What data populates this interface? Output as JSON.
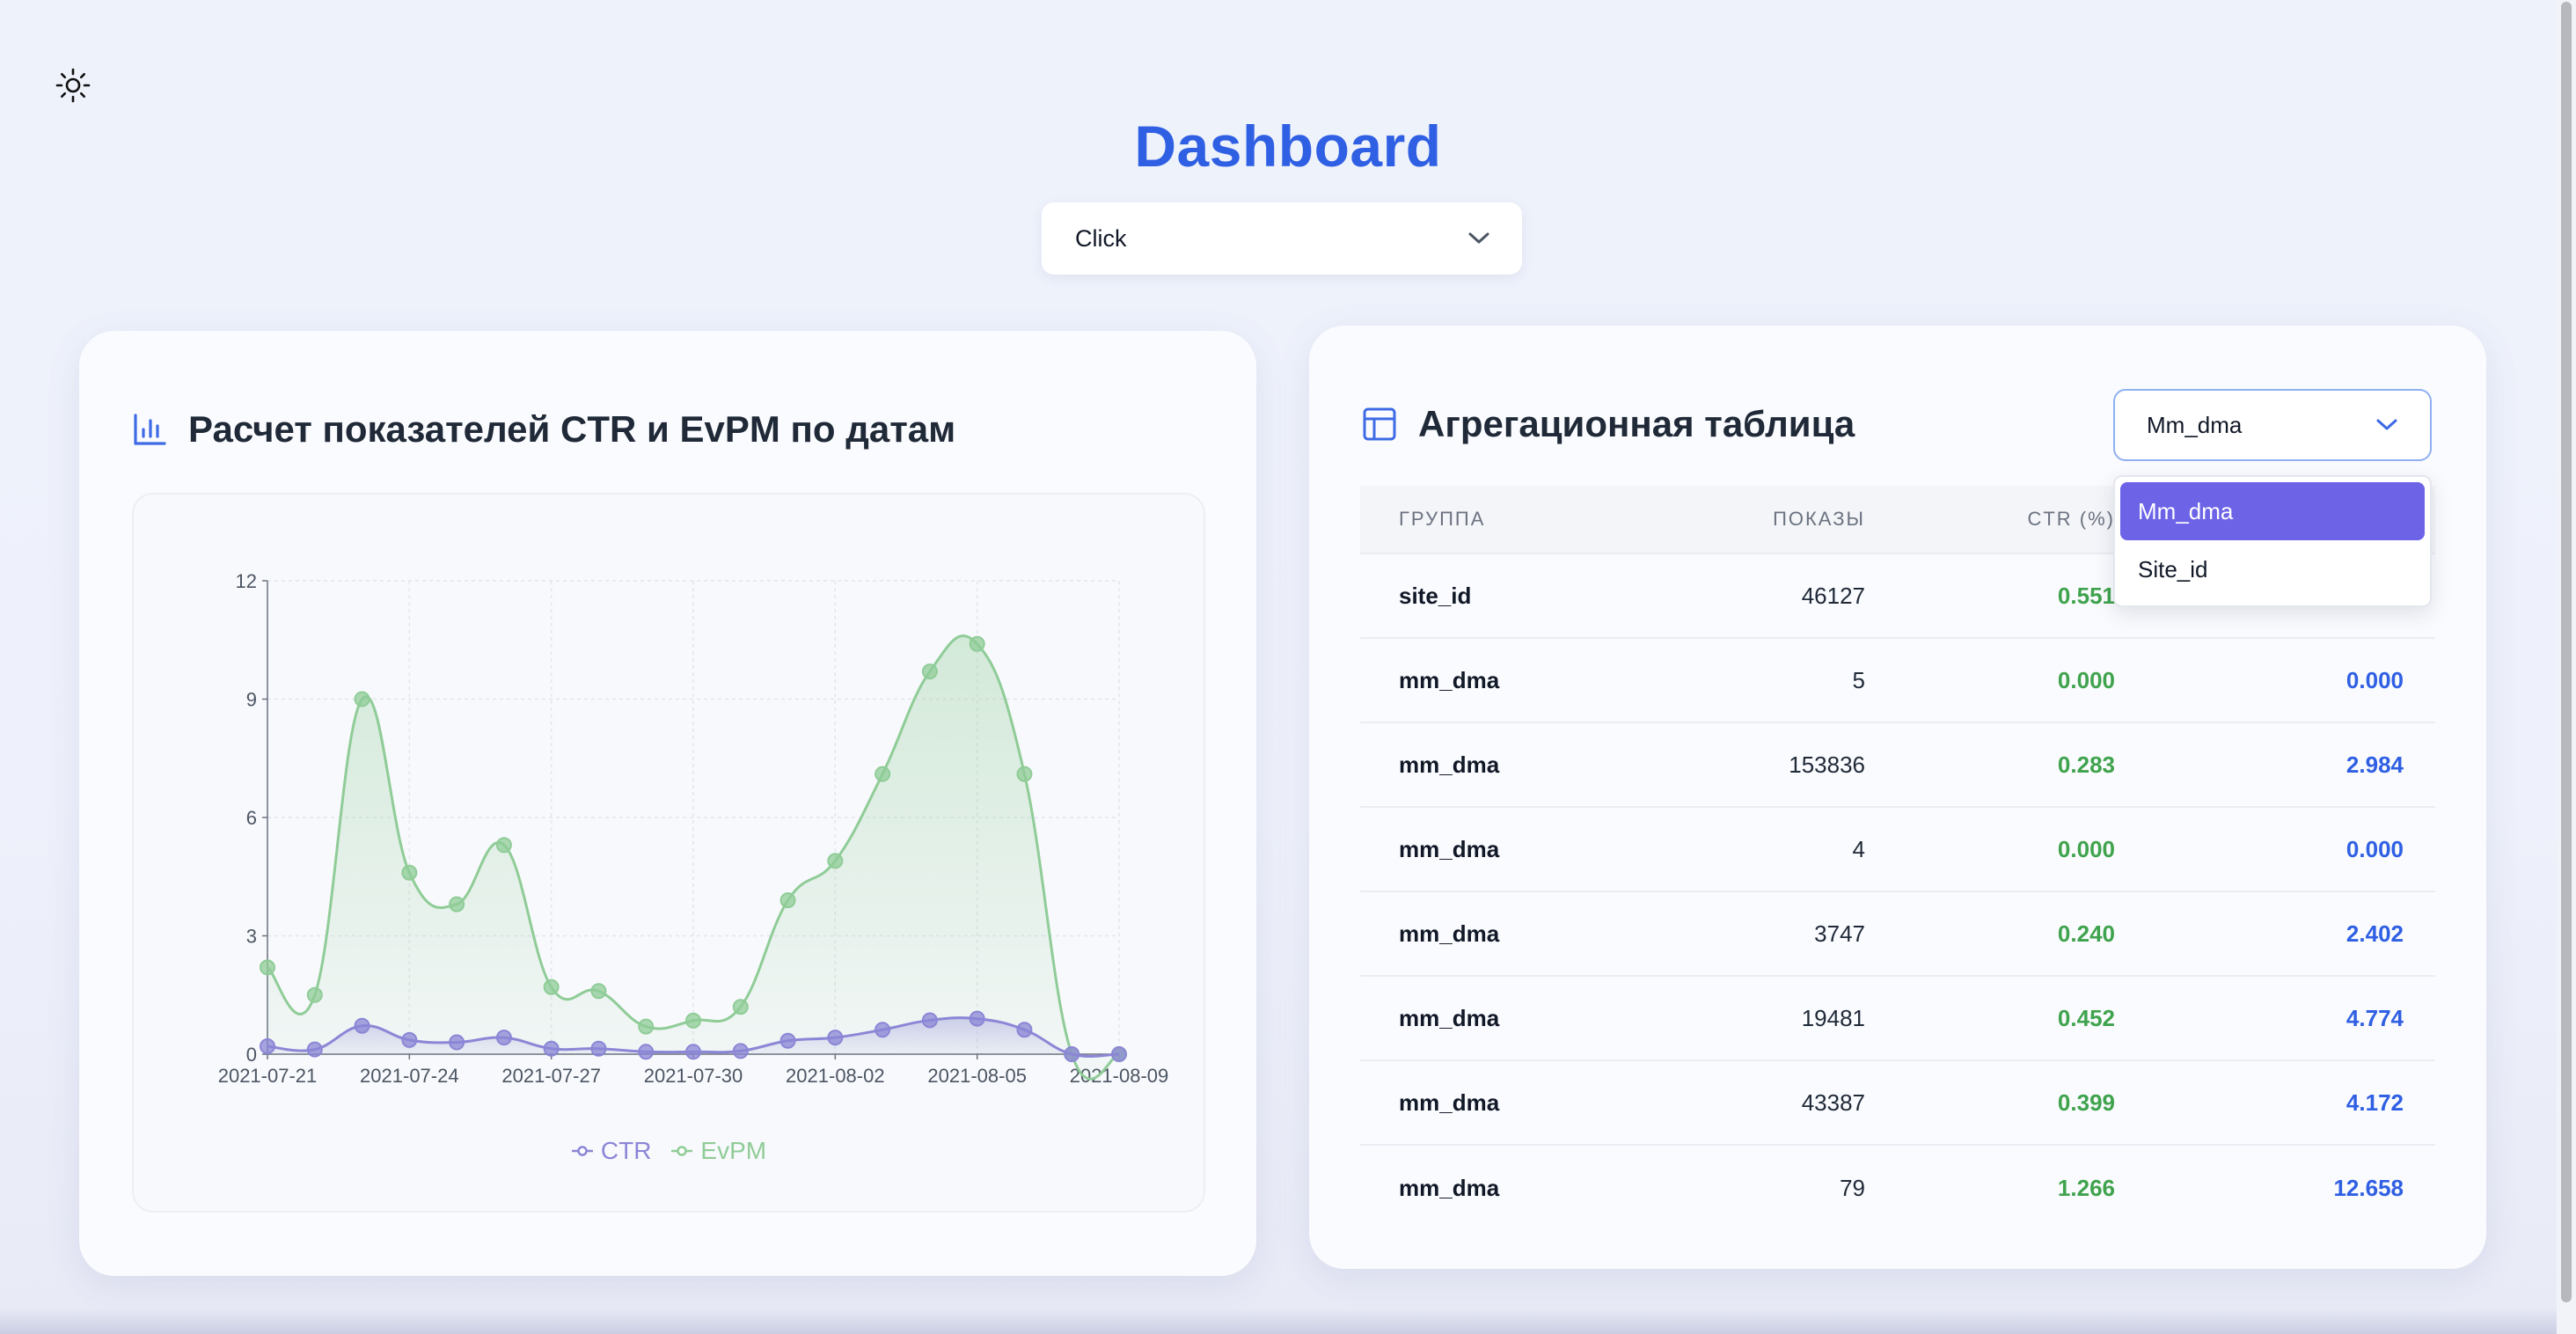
{
  "page": {
    "title": "Dashboard",
    "theme_toggle_icon": "sun-icon"
  },
  "event_select": {
    "value": "Click",
    "icon": "chevron-down-icon"
  },
  "chart_card": {
    "title": "Расчет показателей CTR и EvPM по датам",
    "icon": "bar-chart-icon"
  },
  "chart_data": {
    "type": "line",
    "title": "",
    "xlabel": "",
    "ylabel": "",
    "ylim": [
      0,
      12
    ],
    "yticks": [
      "0",
      "3",
      "6",
      "9",
      "12"
    ],
    "xticks": [
      "2021-07-21",
      "2021-07-24",
      "2021-07-27",
      "2021-07-30",
      "2021-08-02",
      "2021-08-05",
      "2021-08-09"
    ],
    "x": [
      "2021-07-21",
      "2021-07-22",
      "2021-07-23",
      "2021-07-24",
      "2021-07-25",
      "2021-07-26",
      "2021-07-27",
      "2021-07-28",
      "2021-07-29",
      "2021-07-30",
      "2021-07-31",
      "2021-08-01",
      "2021-08-02",
      "2021-08-03",
      "2021-08-04",
      "2021-08-05",
      "2021-08-06",
      "2021-08-07",
      "2021-08-08"
    ],
    "grid": true,
    "legend": "bottom-center",
    "series": [
      {
        "name": "CTR",
        "color": "#8b86d6",
        "values": [
          0.2,
          0.12,
          0.72,
          0.36,
          0.3,
          0.42,
          0.14,
          0.14,
          0.06,
          0.06,
          0.08,
          0.34,
          0.42,
          0.62,
          0.86,
          0.9,
          0.62,
          0.0,
          0.0
        ]
      },
      {
        "name": "EvPM",
        "color": "#8fcc97",
        "values": [
          2.2,
          1.5,
          9.0,
          4.6,
          3.8,
          5.3,
          1.7,
          1.6,
          0.7,
          0.85,
          1.2,
          3.9,
          4.9,
          7.1,
          9.7,
          10.4,
          7.1,
          0.0,
          0.0
        ]
      }
    ]
  },
  "table_card": {
    "title": "Агрегационная таблица",
    "icon": "table-icon",
    "group_select": {
      "value": "Mm_dma",
      "icon": "chevron-down-icon"
    },
    "dropdown_options": [
      "Mm_dma",
      "Site_id"
    ],
    "columns": [
      "ГРУППА",
      "ПОКАЗЫ",
      "CTR (%)",
      ""
    ],
    "rows": [
      {
        "group": "site_id",
        "impressions": "46127",
        "ctr": "0.551",
        "evpm": ""
      },
      {
        "group": "mm_dma",
        "impressions": "5",
        "ctr": "0.000",
        "evpm": "0.000"
      },
      {
        "group": "mm_dma",
        "impressions": "153836",
        "ctr": "0.283",
        "evpm": "2.984"
      },
      {
        "group": "mm_dma",
        "impressions": "4",
        "ctr": "0.000",
        "evpm": "0.000"
      },
      {
        "group": "mm_dma",
        "impressions": "3747",
        "ctr": "0.240",
        "evpm": "2.402"
      },
      {
        "group": "mm_dma",
        "impressions": "19481",
        "ctr": "0.452",
        "evpm": "4.774"
      },
      {
        "group": "mm_dma",
        "impressions": "43387",
        "ctr": "0.399",
        "evpm": "4.172"
      },
      {
        "group": "mm_dma",
        "impressions": "79",
        "ctr": "1.266",
        "evpm": "12.658"
      }
    ]
  }
}
